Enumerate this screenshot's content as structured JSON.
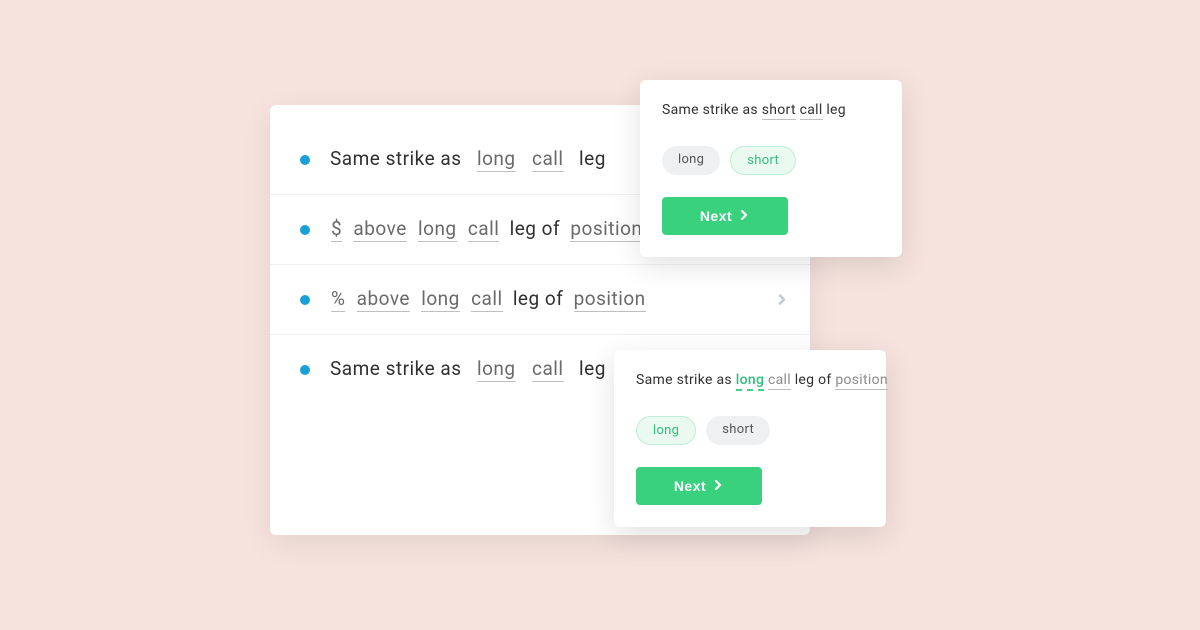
{
  "main": {
    "rows": [
      {
        "pre": "Same strike as",
        "tokens": [
          "long",
          "call"
        ],
        "post": "leg"
      },
      {
        "pre": "",
        "tokens": [
          "$",
          "above",
          "long",
          "call"
        ],
        "mid": "leg of",
        "tokens2": [
          "position"
        ],
        "post": ""
      },
      {
        "pre": "",
        "tokens": [
          "%",
          "above",
          "long",
          "call"
        ],
        "mid": "leg of",
        "tokens2": [
          "position"
        ],
        "post": "",
        "hasChevron": true
      },
      {
        "pre": "Same strike as",
        "tokens": [
          "long",
          "call"
        ],
        "post": "leg"
      }
    ]
  },
  "popup1": {
    "title_pre": "Same strike as",
    "title_tok1": "short",
    "title_tok2": "call",
    "title_post": "leg",
    "chips": {
      "grey": "long",
      "green": "short"
    },
    "next": "Next"
  },
  "popup2": {
    "title_pre": "Same strike as",
    "title_green": "long",
    "title_tok": "call",
    "title_mid": "leg of",
    "title_tok2": "position",
    "chips": {
      "green": "long",
      "grey": "short"
    },
    "next": "Next"
  }
}
